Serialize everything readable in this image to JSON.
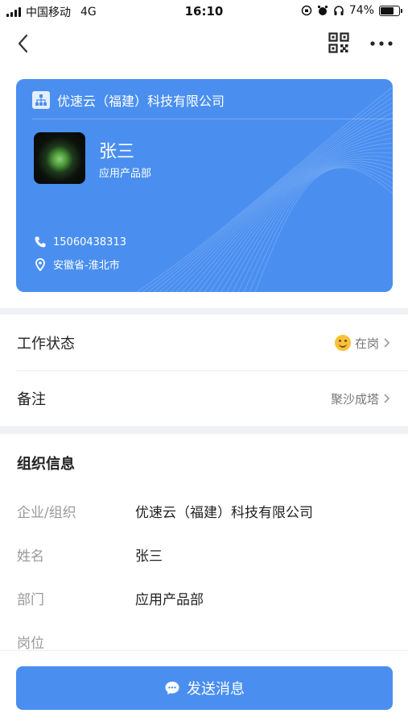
{
  "status_bar": {
    "carrier": "中国移动",
    "network": "4G",
    "time": "16:10",
    "battery_text": "74%",
    "battery_level": 0.74
  },
  "card": {
    "company": "优速云（福建）科技有限公司",
    "name": "张三",
    "department": "应用产品部",
    "phone": "15060438313",
    "location": "安徽省-淮北市",
    "color": "#4a8ff0"
  },
  "rows": {
    "work_status_label": "工作状态",
    "work_status_value": "在岗",
    "note_label": "备注",
    "note_value": "聚沙成塔"
  },
  "org_info": {
    "title": "组织信息",
    "fields": [
      {
        "label": "企业/组织",
        "value": "优速云（福建）科技有限公司"
      },
      {
        "label": "姓名",
        "value": "张三"
      },
      {
        "label": "部门",
        "value": "应用产品部"
      },
      {
        "label": "岗位",
        "value": ""
      }
    ]
  },
  "actions": {
    "send_message": "发送消息"
  },
  "icons": [
    "back-icon",
    "qr-code-icon",
    "more-icon",
    "org-icon",
    "phone-icon",
    "location-icon",
    "chevron-right-icon",
    "chat-icon"
  ]
}
